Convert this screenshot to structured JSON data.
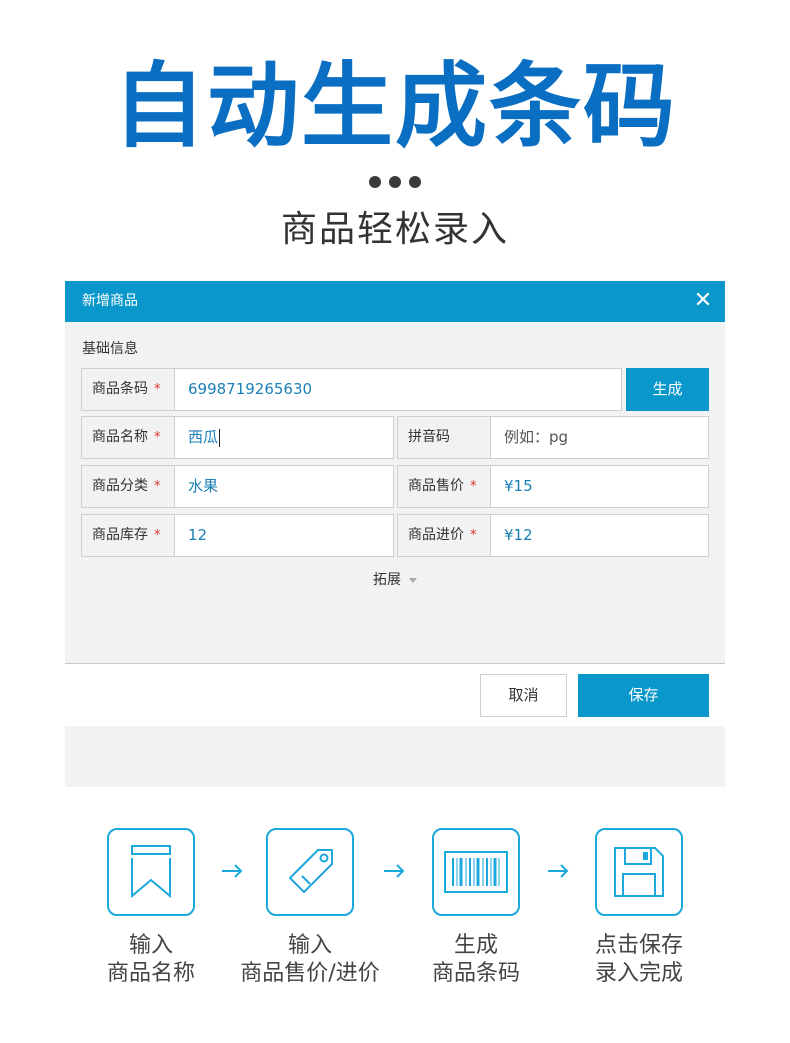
{
  "hero": {
    "title": "自动生成条码",
    "subtitle": "商品轻松录入"
  },
  "dialog": {
    "title": "新增商品",
    "close_icon": "close-icon",
    "section_title": "基础信息",
    "fields": {
      "barcode": {
        "label": "商品条码",
        "required": "*",
        "value": "6998719265630"
      },
      "name": {
        "label": "商品名称",
        "required": "*",
        "value": "西瓜"
      },
      "pinyin": {
        "label": "拼音码",
        "placeholder": "例如：pg"
      },
      "category": {
        "label": "商品分类",
        "required": "*",
        "value": "水果"
      },
      "sale_price": {
        "label": "商品售价",
        "required": "*",
        "value": "¥15"
      },
      "stock": {
        "label": "商品库存",
        "required": "*",
        "value": "12"
      },
      "purchase_price": {
        "label": "商品进价",
        "required": "*",
        "value": "¥12"
      }
    },
    "generate_label": "生成",
    "expand_label": "拓展",
    "cancel_label": "取消",
    "save_label": "保存"
  },
  "steps": [
    {
      "line1": "输入",
      "line2": "商品名称",
      "icon": "bookmark-icon"
    },
    {
      "line1": "输入",
      "line2": "商品售价/进价",
      "icon": "price-tag-icon"
    },
    {
      "line1": "生成",
      "line2": "商品条码",
      "icon": "barcode-icon"
    },
    {
      "line1": "点击保存",
      "line2": "录入完成",
      "icon": "floppy-disk-icon"
    }
  ],
  "colors": {
    "title_blue": "#0a6fc2",
    "header_blue": "#0a97cc",
    "icon_cyan": "#1ba8dc",
    "required_red": "#d9342b"
  }
}
